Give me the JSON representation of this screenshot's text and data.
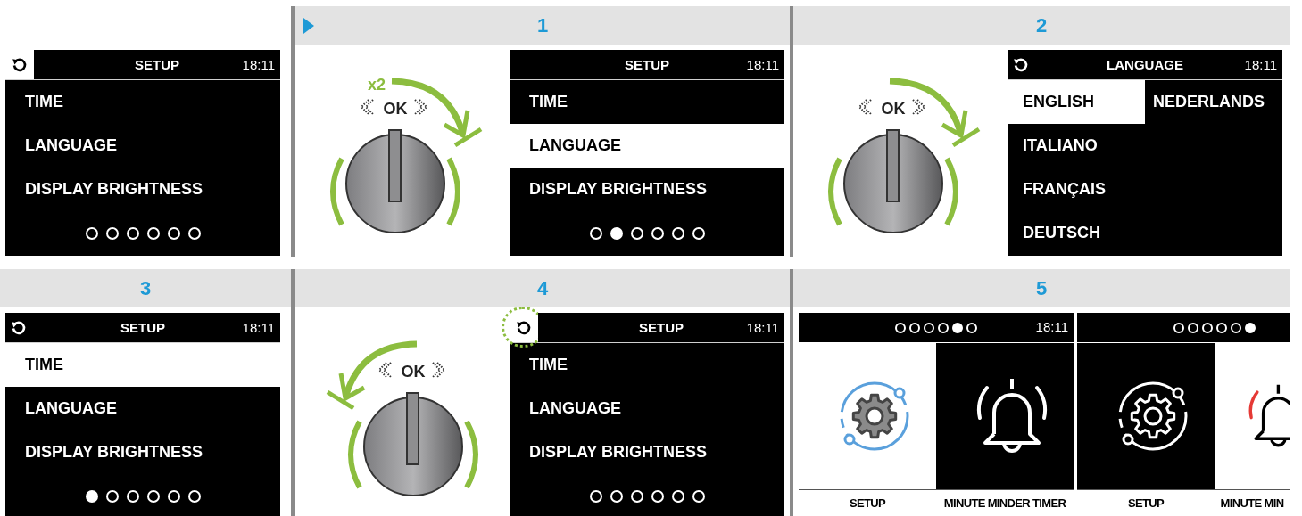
{
  "rows": [
    {
      "panels": [
        {
          "screens": [
            {
              "kind": "menu",
              "back": {
                "selected": true,
                "highlighted": false
              },
              "title": "SETUP",
              "time": "18:11",
              "items": [
                {
                  "label": "TIME",
                  "selected": false
                },
                {
                  "label": "LANGUAGE",
                  "selected": false
                },
                {
                  "label": "DISPLAY BRIGHTNESS",
                  "selected": false
                }
              ],
              "dots": [
                {
                  "selected": false
                },
                {
                  "selected": false
                },
                {
                  "selected": false
                },
                {
                  "selected": false
                },
                {
                  "selected": false
                },
                {
                  "selected": false
                }
              ]
            }
          ]
        },
        {
          "label": "1",
          "marker": true,
          "knob": {
            "kind": "clockwise",
            "ok_label": "OK",
            "press_count": "x2"
          },
          "screens": [
            {
              "kind": "menu",
              "title": "SETUP",
              "time": "18:11",
              "items": [
                {
                  "label": "TIME",
                  "selected": false
                },
                {
                  "label": "LANGUAGE",
                  "selected": true
                },
                {
                  "label": "DISPLAY BRIGHTNESS",
                  "selected": false
                }
              ],
              "dots": [
                {
                  "selected": false
                },
                {
                  "selected": true
                },
                {
                  "selected": false
                },
                {
                  "selected": false
                },
                {
                  "selected": false
                },
                {
                  "selected": false
                }
              ]
            }
          ]
        },
        {
          "label": "2",
          "knob": {
            "kind": "clockwise",
            "ok_label": "OK"
          },
          "screens": [
            {
              "kind": "language",
              "back": {
                "selected": false,
                "highlighted": false
              },
              "title": "LANGUAGE",
              "time": "18:11",
              "columns": [
                [
                  {
                    "label": "ENGLISH",
                    "selected": true
                  },
                  {
                    "label": "ITALIANO",
                    "selected": false
                  },
                  {
                    "label": "FRANÇAIS",
                    "selected": false
                  },
                  {
                    "label": "DEUTSCH",
                    "selected": false
                  }
                ],
                [
                  {
                    "label": "NEDERLANDS",
                    "selected": false
                  }
                ]
              ]
            }
          ]
        }
      ]
    },
    {
      "panels": [
        {
          "label": "3",
          "screens": [
            {
              "kind": "menu",
              "back": {
                "selected": false,
                "highlighted": false
              },
              "title": "SETUP",
              "time": "18:11",
              "items": [
                {
                  "label": "TIME",
                  "selected": true
                },
                {
                  "label": "LANGUAGE",
                  "selected": false
                },
                {
                  "label": "DISPLAY BRIGHTNESS",
                  "selected": false
                }
              ],
              "dots": [
                {
                  "selected": true
                },
                {
                  "selected": false
                },
                {
                  "selected": false
                },
                {
                  "selected": false
                },
                {
                  "selected": false
                },
                {
                  "selected": false
                }
              ]
            }
          ]
        },
        {
          "label": "4",
          "knob": {
            "kind": "counterclockwise",
            "ok_label": "OK"
          },
          "screens": [
            {
              "kind": "menu",
              "back": {
                "selected": true,
                "highlighted": true
              },
              "title": "SETUP",
              "time": "18:11",
              "items": [
                {
                  "label": "TIME",
                  "selected": false
                },
                {
                  "label": "LANGUAGE",
                  "selected": false
                },
                {
                  "label": "DISPLAY BRIGHTNESS",
                  "selected": false
                }
              ],
              "dots": [
                {
                  "selected": false
                },
                {
                  "selected": false
                },
                {
                  "selected": false
                },
                {
                  "selected": false
                },
                {
                  "selected": false
                },
                {
                  "selected": false
                }
              ]
            }
          ]
        },
        {
          "label": "5",
          "screens": [
            {
              "kind": "home",
              "time": "18:11",
              "dots": [
                {
                  "selected": false
                },
                {
                  "selected": false
                },
                {
                  "selected": false
                },
                {
                  "selected": false
                },
                {
                  "selected": true
                },
                {
                  "selected": false
                }
              ],
              "tiles": [
                {
                  "label": "SETUP",
                  "kind": "gear",
                  "selected": true
                },
                {
                  "label": "MINUTE MINDER TIMER",
                  "kind": "bell",
                  "selected": false
                }
              ]
            },
            {
              "kind": "home",
              "dots": [
                {
                  "selected": false
                },
                {
                  "selected": false
                },
                {
                  "selected": false
                },
                {
                  "selected": false
                },
                {
                  "selected": false
                },
                {
                  "selected": true
                }
              ],
              "tiles": [
                {
                  "label": "SETUP",
                  "kind": "gear",
                  "selected": false
                },
                {
                  "label": "MINUTE MIN",
                  "kind": "bell",
                  "selected": true
                }
              ]
            }
          ]
        }
      ]
    }
  ]
}
